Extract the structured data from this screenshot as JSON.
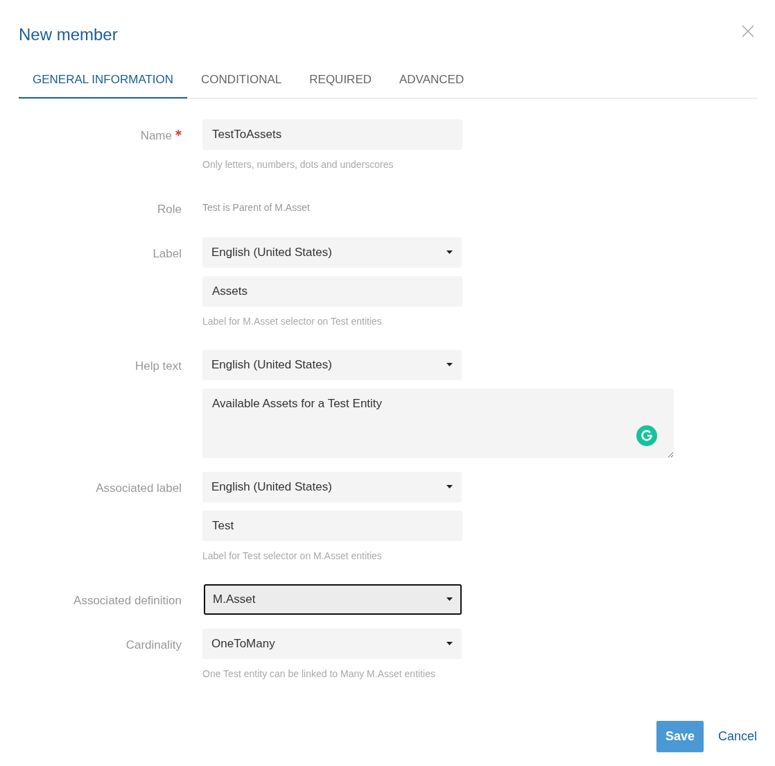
{
  "dialog": {
    "title": "New member"
  },
  "tabs": [
    {
      "label": "GENERAL INFORMATION",
      "selected": true
    },
    {
      "label": "CONDITIONAL",
      "selected": false
    },
    {
      "label": "REQUIRED",
      "selected": false
    },
    {
      "label": "ADVANCED",
      "selected": false
    }
  ],
  "fields": [
    {
      "label": "Name",
      "required": true,
      "controls": [
        {
          "kind": "input",
          "value": "TestToAssets"
        }
      ],
      "hint": "Only letters, numbers, dots and underscores"
    },
    {
      "label": "Role",
      "required": false,
      "controls": [
        {
          "kind": "text",
          "value": "Test is Parent of M.Asset"
        }
      ]
    },
    {
      "label": "Label",
      "required": false,
      "controls": [
        {
          "kind": "select",
          "value": "English (United States)",
          "focused": false
        },
        {
          "kind": "input",
          "value": "Assets"
        }
      ],
      "hint": "Label for M.Asset selector on Test entities"
    },
    {
      "label": "Help text",
      "required": false,
      "controls": [
        {
          "kind": "select",
          "value": "English (United States)",
          "focused": false
        },
        {
          "kind": "textarea",
          "value": "Available Assets for a Test Entity"
        }
      ]
    },
    {
      "label": "Associated label",
      "required": false,
      "controls": [
        {
          "kind": "select",
          "value": "English (United States)",
          "focused": false
        },
        {
          "kind": "input",
          "value": "Test"
        }
      ],
      "hint": "Label for Test selector on M.Asset entities"
    },
    {
      "label": "Associated definition",
      "required": false,
      "controls": [
        {
          "kind": "select",
          "value": "M.Asset",
          "focused": true
        }
      ]
    },
    {
      "label": "Cardinality",
      "required": false,
      "controls": [
        {
          "kind": "select",
          "value": "OneToMany",
          "focused": false
        }
      ],
      "hint": "One Test entity can be linked to Many M.Asset entities"
    }
  ],
  "buttons": {
    "save": "Save",
    "cancel": "Cancel"
  }
}
